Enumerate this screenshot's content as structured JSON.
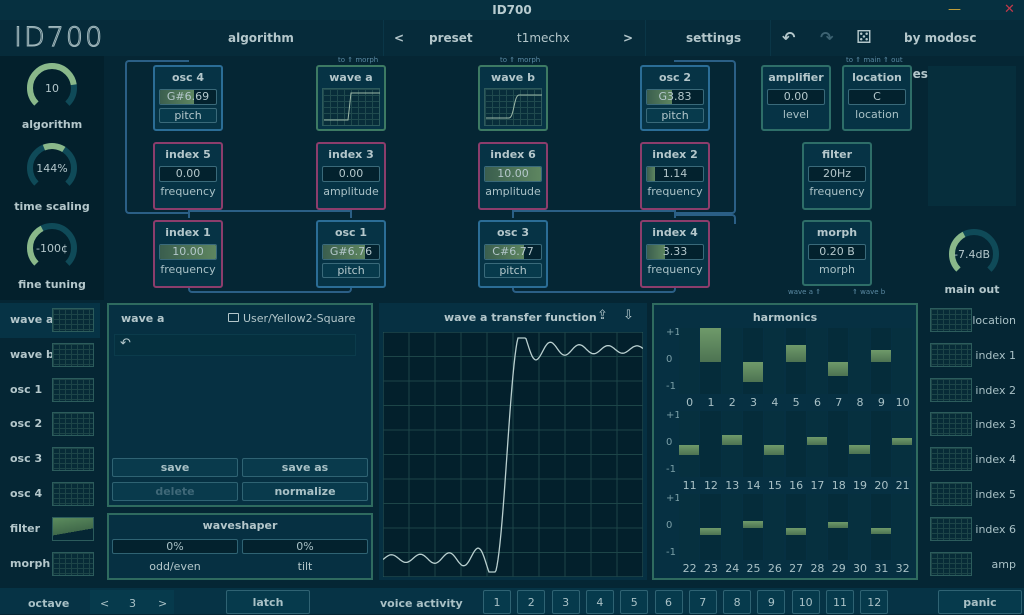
{
  "window": {
    "title": "ID700",
    "minimize": "—",
    "close": "✕"
  },
  "header": {
    "logo": "ID700",
    "algorithm_tab": "algorithm",
    "prev": "<",
    "preset_label": "preset",
    "preset_name": "t1mechx",
    "next": ">",
    "settings": "settings",
    "undo_icon": "↶",
    "redo_icon": "↷",
    "randomize_icon": "⚄",
    "credit": "by modosc designs"
  },
  "knobs": [
    {
      "value": "10",
      "label": "algorithm",
      "fraction": 0.8
    },
    {
      "value": "144%",
      "label": "time scaling",
      "fraction": 0.2
    },
    {
      "value": "-100¢",
      "label": "fine tuning",
      "fraction": 0.4
    }
  ],
  "nodes": {
    "osc4": {
      "title": "osc 4",
      "value": "G#6.69",
      "sub": "pitch",
      "fill": 0.6
    },
    "wave_a": {
      "title": "wave a",
      "note": "to ⇑ morph"
    },
    "wave_b": {
      "title": "wave b",
      "note": "to ⇑ morph"
    },
    "osc2": {
      "title": "osc 2",
      "value": "G3.83",
      "sub": "pitch",
      "fill": 0.45
    },
    "index5": {
      "title": "index 5",
      "value": "0.00",
      "sub": "frequency",
      "fill": 0
    },
    "index3": {
      "title": "index 3",
      "value": "0.00",
      "sub": "amplitude",
      "fill": 0
    },
    "index6": {
      "title": "index 6",
      "value": "10.00",
      "sub": "amplitude",
      "fill": 1
    },
    "index2": {
      "title": "index 2",
      "value": "1.14",
      "sub": "frequency",
      "fill": 0.12
    },
    "index1": {
      "title": "index 1",
      "value": "10.00",
      "sub": "frequency",
      "fill": 1
    },
    "osc1": {
      "title": "osc 1",
      "value": "G#6.76",
      "sub": "pitch",
      "fill": 0.75
    },
    "osc3": {
      "title": "osc 3",
      "value": "C#6.77",
      "sub": "pitch",
      "fill": 0.7
    },
    "index4": {
      "title": "index 4",
      "value": "3.33",
      "sub": "frequency",
      "fill": 0.33
    },
    "amplifier": {
      "title": "amplifier",
      "value": "0.00",
      "sub": "level"
    },
    "location": {
      "title": "location",
      "value": "C",
      "sub": "location",
      "note": "to ⇑ main ⇑ out"
    },
    "filter": {
      "title": "filter",
      "value": "20Hz",
      "sub": "frequency"
    },
    "morph": {
      "title": "morph",
      "value": "0.20 B",
      "sub": "morph",
      "note_left": "wave a ⇑",
      "note_right": "⇑ wave b"
    }
  },
  "main_out": {
    "value": "-7.4dB",
    "label": "main out",
    "fraction": 0.4
  },
  "left_list": [
    "wave a",
    "wave b",
    "osc 1",
    "osc 2",
    "osc 3",
    "osc 4",
    "filter",
    "morph"
  ],
  "right_list": [
    "location",
    "index 1",
    "index 2",
    "index 3",
    "index 4",
    "index 5",
    "index 6",
    "amp"
  ],
  "wave_editor": {
    "title": "wave a",
    "file": "User/Yellow2-Square",
    "undo_icon": "↶",
    "buttons": {
      "save": "save",
      "save_as": "save as",
      "delete": "delete",
      "normalize": "normalize"
    }
  },
  "waveshaper": {
    "title": "waveshaper",
    "odd_even_value": "0%",
    "tilt_value": "0%",
    "odd_even_label": "odd/even",
    "tilt_label": "tilt"
  },
  "transfer": {
    "title": "wave a transfer function",
    "export_icon": "⇪",
    "import_icon": "⇩"
  },
  "harmonics": {
    "title": "harmonics",
    "y_labels": [
      "+1",
      "0",
      "-1"
    ],
    "values": [
      0,
      1.0,
      0,
      -0.6,
      0,
      0.5,
      0,
      -0.4,
      0,
      0.35,
      0,
      -0.3,
      0,
      0.3,
      0,
      -0.3,
      0,
      0.25,
      0,
      -0.25,
      0,
      0.22,
      0,
      -0.2,
      0,
      0.2,
      0,
      -0.2,
      0,
      0.18,
      0,
      -0.18,
      0
    ]
  },
  "footer": {
    "octave_label": "octave",
    "octave_prev": "<",
    "octave_value": "3",
    "octave_next": ">",
    "latch": "latch",
    "voice_activity": "voice activity",
    "voices": [
      "1",
      "2",
      "3",
      "4",
      "5",
      "6",
      "7",
      "8",
      "9",
      "10",
      "11",
      "12"
    ],
    "panic": "panic"
  }
}
